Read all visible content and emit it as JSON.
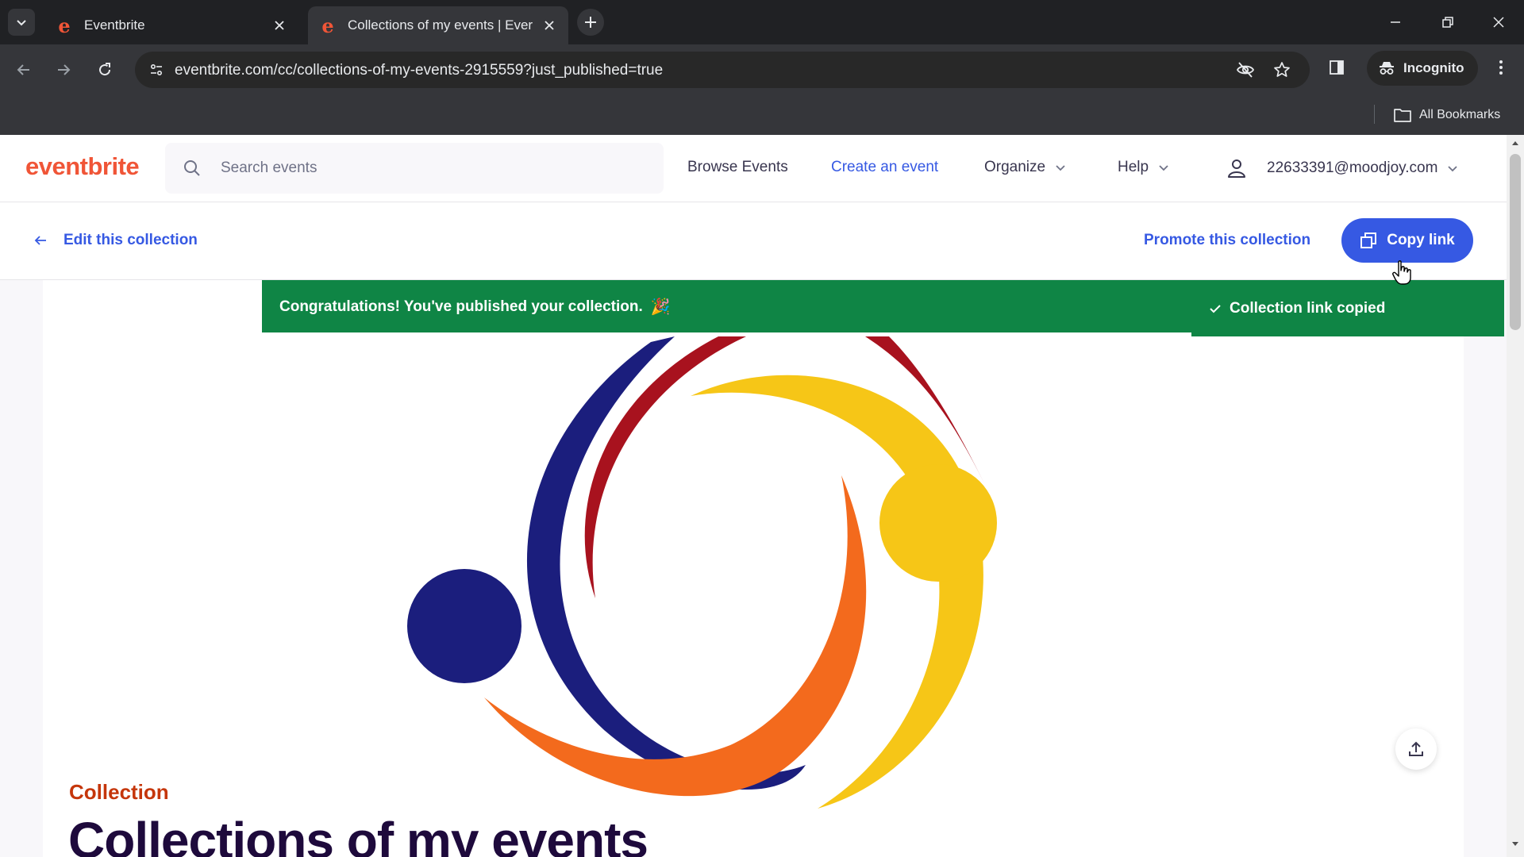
{
  "browser": {
    "tabs": [
      {
        "title": "Eventbrite",
        "active": false,
        "favicon": "eventbrite-e-icon"
      },
      {
        "title": "Collections of my events | Ever",
        "active": true,
        "favicon": "eventbrite-e-icon"
      }
    ],
    "url": "eventbrite.com/cc/collections-of-my-events-2915559?just_published=true",
    "profile_label": "Incognito",
    "bookmarks_label": "All Bookmarks"
  },
  "header": {
    "logo": "eventbrite",
    "search_placeholder": "Search events",
    "nav": {
      "browse": "Browse Events",
      "create": "Create an event",
      "organize": "Organize",
      "help": "Help"
    },
    "user_email": "22633391@moodjoy.com"
  },
  "action_bar": {
    "edit_label": "Edit this collection",
    "promote_label": "Promote this collection",
    "copy_label": "Copy link"
  },
  "banner": {
    "message": "Congratulations! You've published your collection.",
    "emoji": "🎉"
  },
  "toast": {
    "message": "Collection link copied"
  },
  "collection": {
    "label": "Collection",
    "title": "Collections of my events"
  },
  "colors": {
    "brand": "#f05537",
    "link_blue": "#3659e3",
    "success_green": "#0f8545",
    "label_orange": "#c5360b",
    "title_dark": "#1e0a3c"
  }
}
